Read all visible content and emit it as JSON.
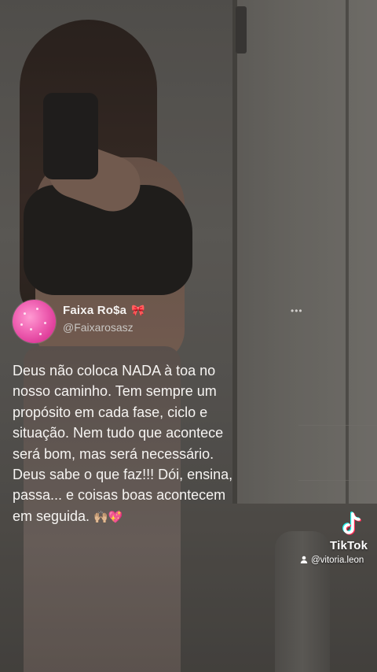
{
  "post": {
    "author_name": "Faixa Ro$a",
    "author_emoji": "🎀",
    "author_handle": "@Faixarosasz",
    "text": "Deus não coloca NADA à toa no\nnosso caminho. Tem sempre um\npropósito em cada fase, ciclo e\nsituação. Nem tudo que acontece\nserá bom, mas será necessário.\nDeus sabe o que faz!!! Dói, ensina,\npassa... e coisas boas acontecem\nem seguida.",
    "text_emoji": "🙌🏼💖"
  },
  "watermark": {
    "brand": "TikTok",
    "username": "@vitoria.leon",
    "icon": "tiktok-logo-icon",
    "user_icon": "person-icon"
  },
  "colors": {
    "avatar_pink": "#f064b4",
    "text_white": "#f6f4f2",
    "handle_gray": "#c9c6c3",
    "tiktok_cyan": "#25f4ee",
    "tiktok_red": "#fe2c55"
  }
}
